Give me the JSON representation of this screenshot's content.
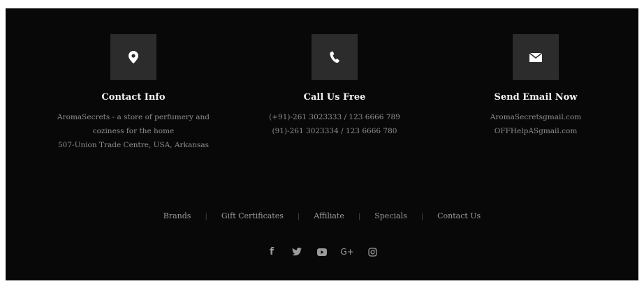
{
  "contact": {
    "icon": "map-marker-icon",
    "title": "Contact Info",
    "lines": [
      "AromaSecrets - a store of perfumery and",
      "coziness for the home",
      "507-Union Trade Centre, USA, Arkansas"
    ]
  },
  "call": {
    "icon": "phone-icon",
    "title": "Call Us Free",
    "lines": [
      "(+91)-261 3023333 / 123 6666 789",
      "(91)-261 3023334 / 123 6666 780"
    ]
  },
  "email": {
    "icon": "envelope-icon",
    "title": "Send Email Now",
    "lines": [
      "AromaSecretsgmail.com",
      "OFFHelpASgmail.com"
    ]
  },
  "links": [
    "Brands",
    "Gift Certificates",
    "Affiliate",
    "Specials",
    "Contact Us"
  ],
  "separator": "|",
  "social": {
    "facebook": "f",
    "google_plus": "G+"
  },
  "colors": {
    "background": "#080808",
    "icon_box": "#2c2c2c",
    "title": "#f2f2f2",
    "text": "#8f8f8f"
  }
}
